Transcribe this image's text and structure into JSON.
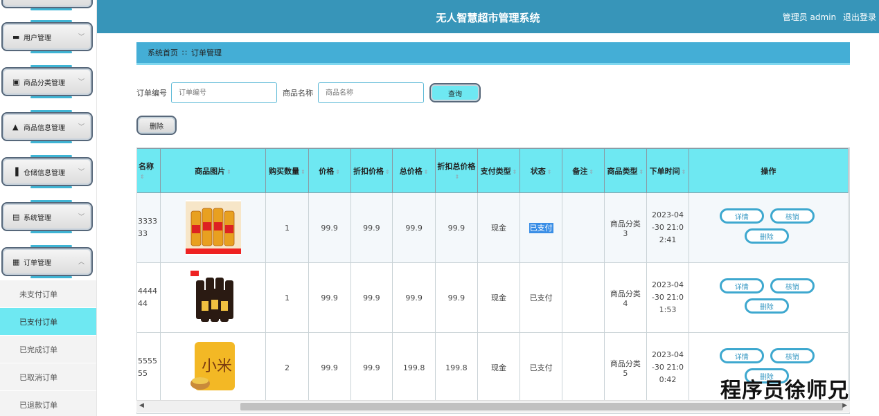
{
  "header": {
    "title": "无人智慧超市管理系统",
    "user": "管理员 admin",
    "logout": "退出登录"
  },
  "sidebar": {
    "items": [
      {
        "label": "用户管理",
        "icon": "user-group-icon"
      },
      {
        "label": "商品分类管理",
        "icon": "clipboard-x-icon"
      },
      {
        "label": "商品信息管理",
        "icon": "person-icon"
      },
      {
        "label": "仓储信息管理",
        "icon": "library-icon"
      },
      {
        "label": "系统管理",
        "icon": "document-icon"
      },
      {
        "label": "订单管理",
        "icon": "grid-icon"
      }
    ],
    "subitems": [
      "未支付订单",
      "已支付订单",
      "已完成订单",
      "已取消订单",
      "已退款订单"
    ],
    "active_sub": "已支付订单"
  },
  "breadcrumb": {
    "home": "系统首页",
    "sep": "∷",
    "current": "订单管理"
  },
  "search": {
    "order_label": "订单编号",
    "order_placeholder": "订单编号",
    "name_label": "商品名称",
    "name_placeholder": "商品名称",
    "query": "查询",
    "delete": "删除"
  },
  "table": {
    "headers": [
      "名称",
      "商品图片",
      "购买数量",
      "价格",
      "折扣价格",
      "总价格",
      "折扣总价格",
      "支付类型",
      "状态",
      "备注",
      "商品类型",
      "下单时间",
      "操作"
    ],
    "rows": [
      {
        "name": "3333 33",
        "qty": "1",
        "price": "99.9",
        "discount": "99.9",
        "total": "99.9",
        "discount_total": "99.9",
        "pay": "现金",
        "status": "已支付",
        "note": "",
        "type": "商品分类3",
        "time": "2023-04-30 21:02:41",
        "product": "oil"
      },
      {
        "name": "4444 44",
        "qty": "1",
        "price": "99.9",
        "discount": "99.9",
        "total": "99.9",
        "discount_total": "99.9",
        "pay": "现金",
        "status": "已支付",
        "note": "",
        "type": "商品分类4",
        "time": "2023-04-30 21:01:53",
        "product": "soy"
      },
      {
        "name": "5555 55",
        "qty": "2",
        "price": "99.9",
        "discount": "99.9",
        "total": "199.8",
        "discount_total": "199.8",
        "pay": "现金",
        "status": "已支付",
        "note": "",
        "type": "商品分类5",
        "time": "2023-04-30 21:00:42",
        "product": "rice"
      }
    ],
    "actions": {
      "detail": "详情",
      "verify": "核销",
      "delete": "删除"
    }
  },
  "watermark": "程序员徐师兄",
  "colors": {
    "header": "#3795b9",
    "accent": "#6ee8f2",
    "button_border": "#3ea8cf"
  }
}
